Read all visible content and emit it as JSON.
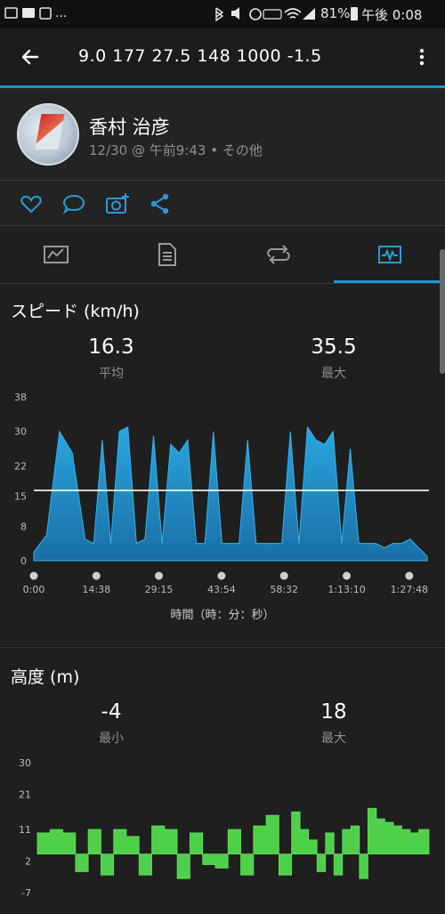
{
  "status_bar": {
    "time": "午後 0:08",
    "battery": "81%",
    "icons": [
      "photo-icon",
      "mail-icon",
      "d-app-icon",
      "bluetooth-icon",
      "mute-icon",
      "alarm-icon",
      "volte-icon",
      "wifi-icon",
      "signal-icon",
      "battery-icon"
    ],
    "more": "..."
  },
  "app_bar": {
    "title": "9.0  177  27.5  148  1000  -1.5"
  },
  "profile": {
    "name": "香村 治彦",
    "meta": "12/30 @ 午前9:43 • その他"
  },
  "speed": {
    "title": "スピード (km/h)",
    "avg_value": "16.3",
    "avg_label": "平均",
    "max_value": "35.5",
    "max_label": "最大",
    "x_axis_label": "時間（時：分：秒）"
  },
  "elevation": {
    "title": "高度 (m)",
    "min_value": "-4",
    "min_label": "最小",
    "max_value": "18",
    "max_label": "最大"
  },
  "chart_data": [
    {
      "type": "area",
      "ylabel": "スピード (km/h)",
      "xlabel": "時間（時：分：秒）",
      "y_ticks": [
        "38",
        "30",
        "22",
        "15",
        "8",
        "0"
      ],
      "y_tick_values": [
        38,
        30,
        22,
        15,
        8,
        0
      ],
      "ylim": [
        0,
        38
      ],
      "x_ticks": [
        "0:00",
        "14:38",
        "29:15",
        "43:54",
        "58:32",
        "1:13:10",
        "1:27:48"
      ],
      "x_minutes": [
        0,
        3,
        6,
        9,
        12,
        14,
        16,
        18,
        20,
        22,
        24,
        26,
        28,
        30,
        32,
        34,
        36,
        38,
        40,
        42,
        44,
        46,
        48,
        50,
        52,
        54,
        56,
        58,
        60,
        62,
        64,
        66,
        68,
        70,
        72,
        74,
        76,
        78,
        80,
        82,
        84,
        86,
        88,
        90,
        92
      ],
      "values": [
        2,
        6,
        30,
        25,
        5,
        4,
        28,
        4,
        30,
        31,
        4,
        5,
        29,
        4,
        27,
        25,
        28,
        4,
        4,
        30,
        4,
        4,
        4,
        28,
        4,
        4,
        4,
        4,
        30,
        4,
        31,
        28,
        27,
        30,
        4,
        26,
        4,
        4,
        4,
        3,
        4,
        4,
        5,
        3,
        1
      ],
      "average": 16.3,
      "series_color": "#1e8fc8"
    },
    {
      "type": "area",
      "ylabel": "高度 (m)",
      "y_ticks": [
        "30",
        "21",
        "11",
        "2",
        "-7"
      ],
      "y_tick_values": [
        30,
        21,
        11,
        2,
        -7
      ],
      "ylim": [
        -7,
        30
      ],
      "x_minutes": [
        0,
        3,
        6,
        9,
        12,
        15,
        18,
        21,
        24,
        27,
        30,
        33,
        36,
        39,
        42,
        45,
        48,
        51,
        54,
        57,
        60,
        62,
        64,
        66,
        68,
        70,
        72,
        74,
        76,
        78,
        80,
        82,
        84,
        86,
        88,
        90,
        92
      ],
      "values": [
        10,
        11,
        10,
        -1,
        11,
        -2,
        11,
        9,
        -2,
        12,
        11,
        -3,
        10,
        1,
        0,
        11,
        -2,
        12,
        15,
        -2,
        16,
        11,
        8,
        -1,
        10,
        -2,
        11,
        12,
        -3,
        17,
        14,
        13,
        12,
        11,
        10,
        11,
        11
      ],
      "series_color": "#4fd04b"
    }
  ]
}
